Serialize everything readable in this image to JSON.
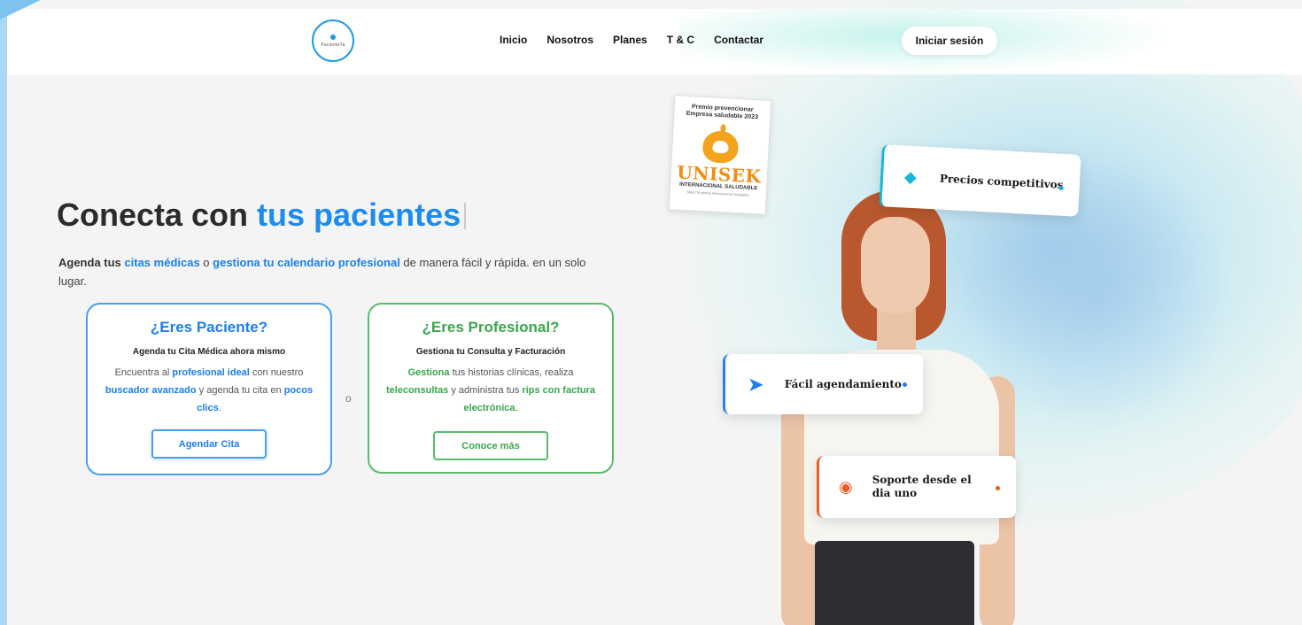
{
  "nav": {
    "logo_text": "PacienteYa",
    "items": [
      "Inicio",
      "Nosotros",
      "Planes",
      "T & C",
      "Contactar"
    ],
    "login": "Iniciar sesión"
  },
  "hero": {
    "title_main": "Conecta con ",
    "title_accent": "tus pacientes",
    "sub_1": "Agenda tus ",
    "sub_2": "citas médicas",
    "sub_3": " o ",
    "sub_4": "gestiona tu calendario profesional",
    "sub_5": " de manera fácil y rápida. en un solo lugar."
  },
  "patient": {
    "title": "¿Eres Paciente?",
    "subtitle": "Agenda tu Cita Médica ahora mismo",
    "t1": "Encuentra al ",
    "t2": "profesional ideal",
    "t3": " con nuestro ",
    "t4": "buscador avanzado",
    "t5": " y agenda tu cita en ",
    "t6": "pocos clics",
    "t7": ".",
    "button": "Agendar Cita"
  },
  "separator": "o",
  "professional": {
    "title": "¿Eres Profesional?",
    "subtitle": "Gestiona tu Consulta y Facturación",
    "t1": "Gestiona",
    "t2": " tus historias clínicas, realiza ",
    "t3": "teleconsultas",
    "t4": " y administra tus ",
    "t5": "rips con factura electrónica",
    "t6": ".",
    "button": "Conoce más"
  },
  "award": {
    "line1": "Premio prevencionar",
    "line2": "Empresa saludable 2023",
    "name": "UNISEK",
    "line3": "INTERNACIONAL SALUDABLE",
    "small": "Mejor Empresa Internacional Saludable"
  },
  "features": [
    {
      "label": "Precios competitivos",
      "icon": "tag-icon",
      "color": "#16b7d7"
    },
    {
      "label": "Fácil agendamiento",
      "icon": "rocket-icon",
      "color": "#1c7ef0"
    },
    {
      "label": "Soporte desde el dia uno",
      "icon": "headset-icon",
      "color": "#f05a28"
    }
  ]
}
